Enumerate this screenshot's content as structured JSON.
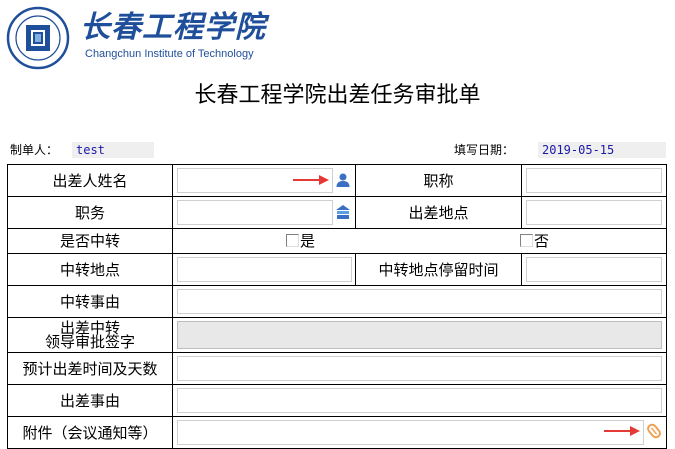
{
  "header": {
    "logo_cn": "长春工程学院",
    "logo_en": "Changchun Institute of Technology",
    "title": "长春工程学院出差任务审批单"
  },
  "meta": {
    "creator_label": "制单人：",
    "creator_value": "test",
    "date_label": "填写日期：",
    "date_value": "2019-05-15"
  },
  "form": {
    "traveler_name_label": "出差人姓名",
    "job_title_label": "职称",
    "position_label": "职务",
    "destination_label": "出差地点",
    "transfer_label": "是否中转",
    "transfer_yes": "是",
    "transfer_no": "否",
    "transfer_location_label": "中转地点",
    "transfer_stay_label": "中转地点停留时间",
    "transfer_reason_label": "中转事由",
    "leader_sign_label_1": "出差中转",
    "leader_sign_label_2": "领导审批签字",
    "duration_label": "预计出差时间及天数",
    "trip_reason_label": "出差事由",
    "attachment_label": "附件（会议通知等）"
  },
  "icons": {
    "person": "person-icon",
    "org": "org-icon",
    "attachment": "paperclip-icon"
  },
  "colors": {
    "brand": "#1f4f9a",
    "arrow": "#e53935",
    "meta_value_text": "#1a1aa6",
    "readonly_bg": "#e8e8e8"
  }
}
